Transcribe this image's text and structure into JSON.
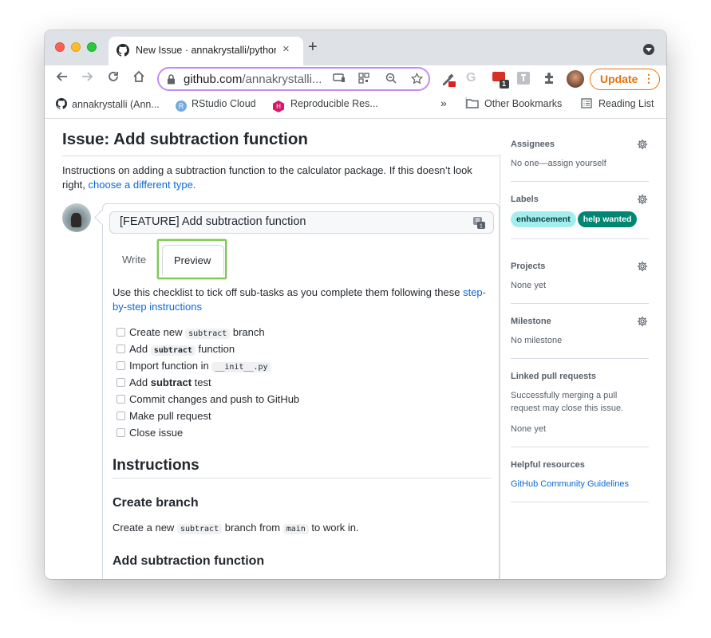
{
  "browser": {
    "tab_title": "New Issue · annakrystalli/python",
    "url_host": "github.com",
    "url_path": "/annakrystalli...",
    "update_label": "Update",
    "ext_badge": "1"
  },
  "bookmarks": {
    "items": [
      "annakrystalli (Ann...",
      "RStudio Cloud",
      "Reproducible Res..."
    ],
    "overflow": "»",
    "other": "Other Bookmarks",
    "reading_list": "Reading List"
  },
  "page": {
    "title": "Issue: Add subtraction function",
    "intro": "Instructions on adding a subtraction function to the calculator package. If this doesn’t look right, ",
    "intro_link": "choose a different type.",
    "issue_title_value": "[FEATURE] Add subtraction function",
    "tab_write": "Write",
    "tab_preview": "Preview",
    "checklist_intro": "Use this checklist to tick off sub-tasks as you complete them following these ",
    "checklist_link": "step-by-step instructions",
    "checklist": [
      {
        "pre": "Create new ",
        "code": "subtract",
        "post": " branch"
      },
      {
        "pre": "Add ",
        "code": "subtract",
        "post": " function"
      },
      {
        "pre": "Import function in ",
        "code": "__init__.py",
        "post": ""
      },
      {
        "pre": "Add ",
        "strong": "subtract",
        "post": " test"
      },
      {
        "pre": "Commit changes and push to GitHub"
      },
      {
        "pre": "Make pull request"
      },
      {
        "pre": "Close issue"
      }
    ],
    "section_heading": "Instructions",
    "create_branch_heading": "Create branch",
    "create_branch_text": {
      "pre": "Create a new ",
      "code1": "subtract",
      "mid": " branch from ",
      "code2": "main",
      "post": " to work in."
    },
    "add_fn_heading": "Add subtraction function"
  },
  "sidebar": {
    "assignees": {
      "heading": "Assignees",
      "value": "No one—assign yourself"
    },
    "labels": {
      "heading": "Labels",
      "items": [
        {
          "name": "enhancement",
          "bg": "#a2eeef",
          "fg": "#0b3a3b"
        },
        {
          "name": "help wanted",
          "bg": "#008672",
          "fg": "#ffffff"
        }
      ]
    },
    "projects": {
      "heading": "Projects",
      "value": "None yet"
    },
    "milestone": {
      "heading": "Milestone",
      "value": "No milestone"
    },
    "linked": {
      "heading": "Linked pull requests",
      "desc": "Successfully merging a pull request may close this issue.",
      "value": "None yet"
    },
    "helpful": {
      "heading": "Helpful resources",
      "link": "GitHub Community Guidelines"
    }
  }
}
